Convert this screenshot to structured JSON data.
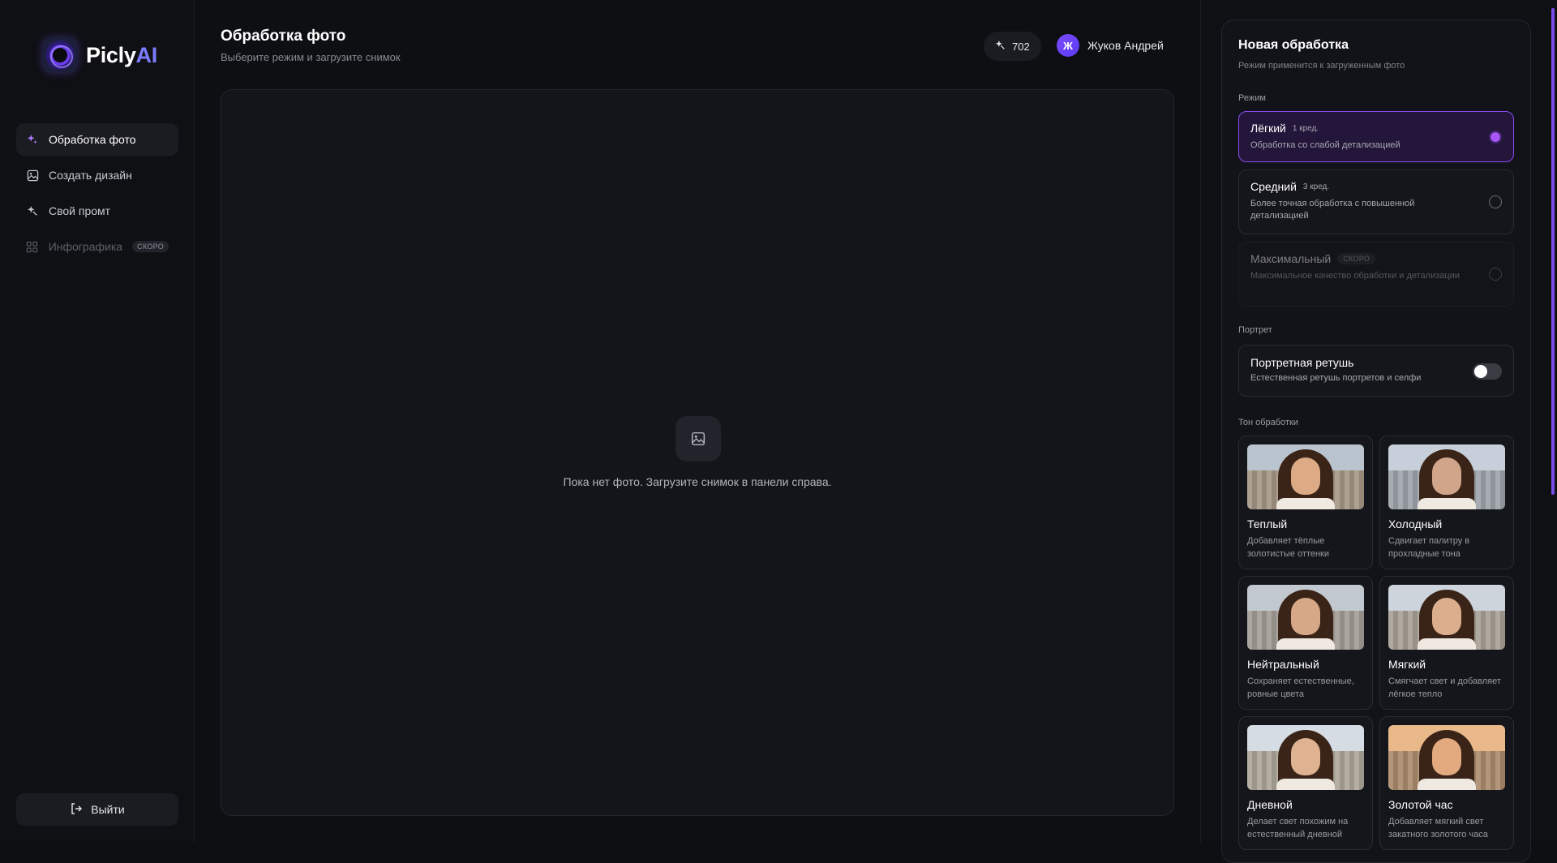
{
  "brand": {
    "name_main": "Picly",
    "name_accent": "AI"
  },
  "sidebar": {
    "items": [
      {
        "label": "Обработка фото",
        "icon": "sparkles-icon",
        "active": true
      },
      {
        "label": "Создать дизайн",
        "icon": "image-icon"
      },
      {
        "label": "Свой промт",
        "icon": "magic-icon"
      },
      {
        "label": "Инфографика",
        "icon": "grid-icon",
        "badge": "СКОРО",
        "disabled": true
      }
    ],
    "logout": "Выйти"
  },
  "header": {
    "title": "Обработка фото",
    "subtitle": "Выберите режим и загрузите снимок",
    "credits": "702",
    "user_initial": "Ж",
    "user_name": "Жуков Андрей"
  },
  "canvas": {
    "empty_text": "Пока нет фото. Загрузите снимок в панели справа."
  },
  "panel": {
    "title": "Новая обработка",
    "subtitle": "Режим применится к загруженным фото",
    "mode_label": "Режим",
    "modes": [
      {
        "name": "Лёгкий",
        "cost": "1 кред.",
        "desc": "Обработка со слабой детализацией",
        "selected": true
      },
      {
        "name": "Средний",
        "cost": "3 кред.",
        "desc": "Более точная обработка с повышенной детализацией"
      },
      {
        "name": "Максимальный",
        "badge": "СКОРО",
        "desc": "Максимальное качество обработки и детализации",
        "disabled": true
      }
    ],
    "portrait_label": "Портрет",
    "retouch": {
      "title": "Портретная ретушь",
      "desc": "Естественная ретушь портретов и селфи",
      "enabled": false
    },
    "tone_label": "Тон обработки",
    "tones": [
      {
        "name": "Теплый",
        "desc": "Добавляет тёплые золотистые оттенки",
        "sky": "#b9c4cf"
      },
      {
        "name": "Холодный",
        "desc": "Сдвигает палитру в прохладные тона",
        "sky": "#c7d0da"
      },
      {
        "name": "Нейтральный",
        "desc": "Сохраняет естественные, ровные цвета",
        "sky": "#c2c8cf"
      },
      {
        "name": "Мягкий",
        "desc": "Смягчает свет и добавляет лёгкое тепло",
        "sky": "#cdd4db"
      },
      {
        "name": "Дневной",
        "desc": "Делает свет похожим на естественный дневной",
        "sky": "#d6dce3"
      },
      {
        "name": "Золотой час",
        "desc": "Добавляет мягкий свет закатного золотого часа",
        "sky": "#e9b98a"
      }
    ]
  },
  "colors": {
    "accent": "#a855f7",
    "selected_bg": "#24163a",
    "avatar": "#7b4cff"
  }
}
